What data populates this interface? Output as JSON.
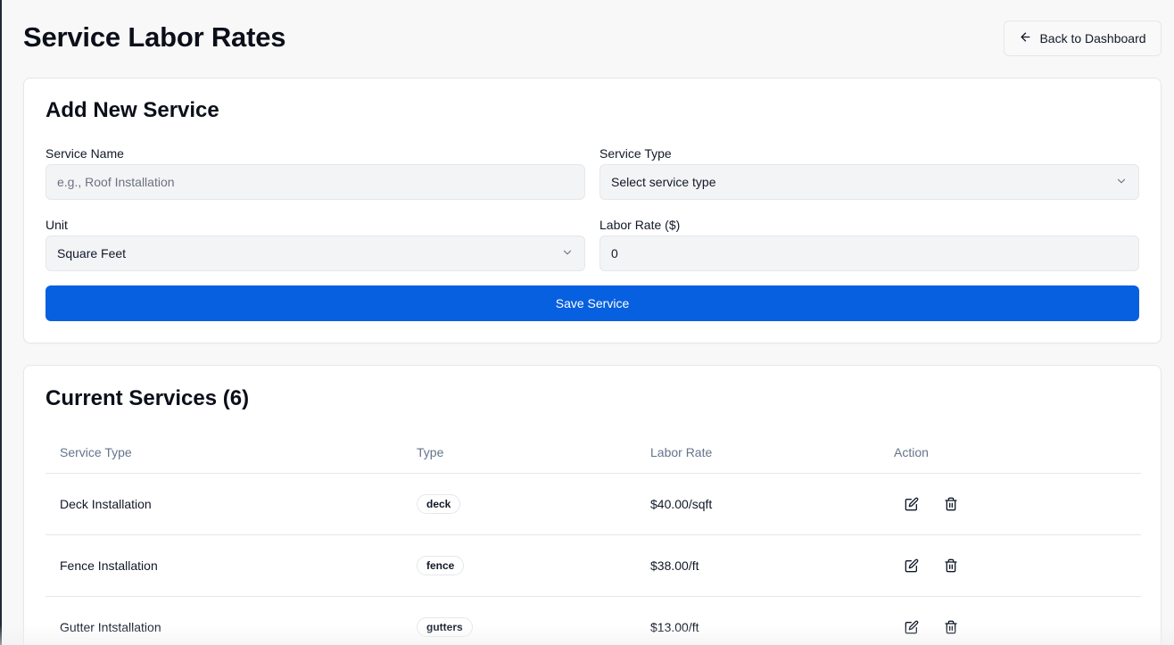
{
  "page": {
    "title": "Service Labor Rates",
    "back_label": "Back to Dashboard"
  },
  "form": {
    "title": "Add New Service",
    "service_name_label": "Service Name",
    "service_name_placeholder": "e.g., Roof Installation",
    "service_name_value": "",
    "service_type_label": "Service Type",
    "service_type_value": "Select service type",
    "unit_label": "Unit",
    "unit_value": "Square Feet",
    "labor_rate_label": "Labor Rate ($)",
    "labor_rate_value": "0",
    "save_label": "Save Service"
  },
  "list": {
    "title": "Current Services (6)",
    "columns": [
      "Service Type",
      "Type",
      "Labor Rate",
      "Action"
    ],
    "rows": [
      {
        "name": "Deck Installation",
        "type": "deck",
        "rate": "$40.00/sqft"
      },
      {
        "name": "Fence Installation",
        "type": "fence",
        "rate": "$38.00/ft"
      },
      {
        "name": "Gutter Intstallation",
        "type": "gutters",
        "rate": "$13.00/ft"
      }
    ]
  },
  "colors": {
    "accent": "#0660e0",
    "background": "#f8f8f8",
    "card": "#ffffff"
  },
  "icons": [
    "arrow-left-icon",
    "chevron-down-icon",
    "edit-icon",
    "trash-icon"
  ]
}
